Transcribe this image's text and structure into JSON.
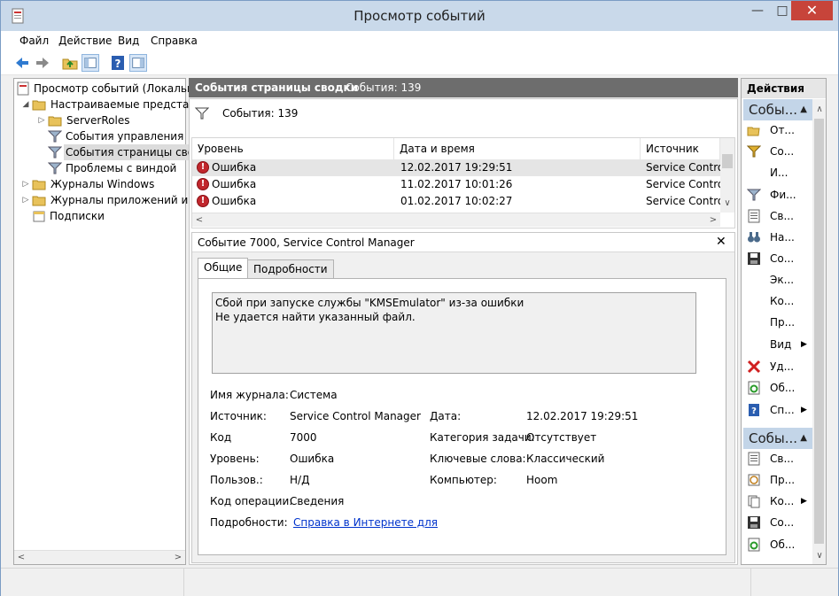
{
  "window": {
    "title": "Просмотр событий",
    "minimize": "—",
    "maximize": "□",
    "close": "✕"
  },
  "menu": [
    "Файл",
    "Действие",
    "Вид",
    "Справка"
  ],
  "tree": {
    "items": [
      {
        "label": "Просмотр событий (Локальны"
      },
      {
        "label": "Настраиваемые представле"
      },
      {
        "label": "ServerRoles"
      },
      {
        "label": "События управления"
      },
      {
        "label": "События страницы свод"
      },
      {
        "label": "Проблемы с виндой"
      },
      {
        "label": "Журналы Windows"
      },
      {
        "label": "Журналы приложений и сл"
      },
      {
        "label": "Подписки"
      }
    ]
  },
  "summary": {
    "header_title": "События страницы сводки",
    "header_count": "События: 139",
    "filter_count": "События: 139"
  },
  "events_table": {
    "columns": [
      "Уровень",
      "Дата и время",
      "Источник"
    ],
    "rows": [
      {
        "level": "Ошибка",
        "datetime": "12.02.2017 19:29:51",
        "source": "Service Control"
      },
      {
        "level": "Ошибка",
        "datetime": "11.02.2017 10:01:26",
        "source": "Service Control"
      },
      {
        "level": "Ошибка",
        "datetime": "01.02.2017 10:02:27",
        "source": "Service Control"
      }
    ]
  },
  "detail": {
    "title": "Событие 7000, Service Control Manager",
    "tabs": [
      "Общие",
      "Подробности"
    ],
    "message_line1": "Сбой при запуске службы \"KMSEmulator\" из-за ошибки",
    "message_line2": "Не удается найти указанный файл.",
    "labels": {
      "log_name": "Имя журнала:",
      "source": "Источник:",
      "code": "Код",
      "level": "Уровень:",
      "user": "Пользов.:",
      "opcode": "Код операции:",
      "more_info": "Подробности:",
      "date": "Дата:",
      "task_category": "Категория задачи:",
      "keywords": "Ключевые слова:",
      "computer": "Компьютер:"
    },
    "values": {
      "log_name": "Система",
      "source": "Service Control Manager",
      "code": "7000",
      "level": "Ошибка",
      "user": "Н/Д",
      "opcode": "Сведения",
      "more_info_link": "Справка в Интернете для",
      "date": "12.02.2017 19:29:51",
      "task_category": "Отсутствует",
      "keywords": "Классический",
      "computer": "Hoom"
    }
  },
  "actions": {
    "header": "Действия",
    "group1": "Собы...",
    "group1_items": [
      "От...",
      "Со...",
      "И...",
      "Фи...",
      "Св...",
      "На...",
      "Со...",
      "Эк...",
      "Ко...",
      "Пр...",
      "Вид",
      "Уд...",
      "Об...",
      "Сп..."
    ],
    "group2": "Собы...",
    "group2_items": [
      "Св...",
      "Пр...",
      "Ко...",
      "Со...",
      "Об..."
    ]
  },
  "colors": {
    "accent": "#c3d5e8",
    "error": "#c1272d",
    "section_header": "#6d6d6d"
  }
}
